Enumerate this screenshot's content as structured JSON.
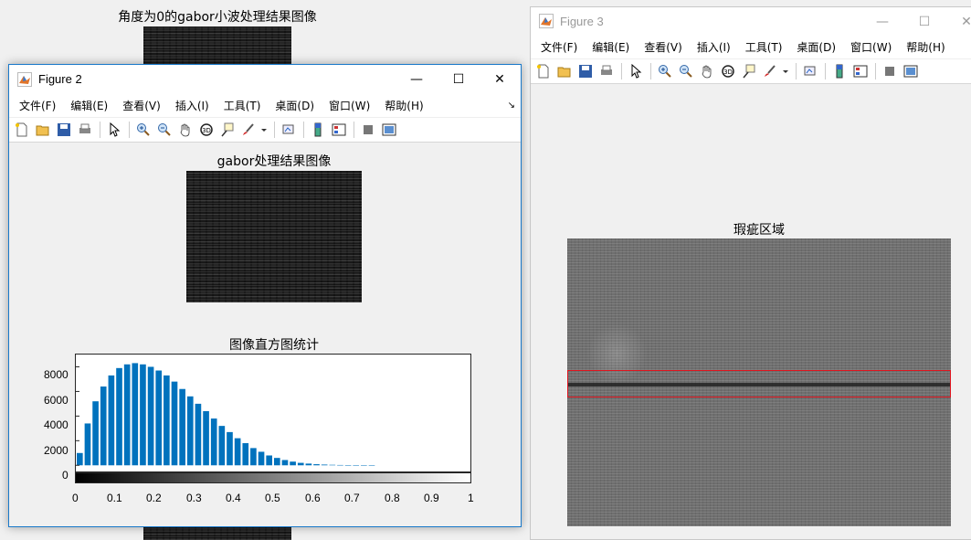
{
  "background_figure": {
    "title": "角度为0的gabor小波处理结果图像"
  },
  "figure2": {
    "window_title": "Figure 2",
    "menu": [
      "文件(F)",
      "编辑(E)",
      "查看(V)",
      "插入(I)",
      "工具(T)",
      "桌面(D)",
      "窗口(W)",
      "帮助(H)"
    ],
    "resize_glyph": "↘",
    "image_title": "gabor处理结果图像",
    "histogram_title": "图像直方图统计",
    "chart_data": {
      "type": "bar",
      "title": "图像直方图统计",
      "xlim": [
        0,
        1
      ],
      "ylim": [
        -500,
        9000
      ],
      "yticks": [
        0,
        2000,
        4000,
        6000,
        8000
      ],
      "xticks": [
        0,
        0.1,
        0.2,
        0.3,
        0.4,
        0.5,
        0.6,
        0.7,
        0.8,
        0.9,
        1
      ],
      "ytick_labels": [
        "8000",
        "6000",
        "4000",
        "2000",
        "0"
      ],
      "xtick_labels": [
        "0",
        "0.1",
        "0.2",
        "0.3",
        "0.4",
        "0.5",
        "0.6",
        "0.7",
        "0.8",
        "0.9",
        "1"
      ],
      "colorbar": "gray",
      "bar_color": "#0072bd",
      "x": [
        0.0,
        0.02,
        0.04,
        0.06,
        0.08,
        0.1,
        0.12,
        0.14,
        0.16,
        0.18,
        0.2,
        0.22,
        0.24,
        0.26,
        0.28,
        0.3,
        0.32,
        0.34,
        0.36,
        0.38,
        0.4,
        0.42,
        0.44,
        0.46,
        0.48,
        0.5,
        0.52,
        0.54,
        0.56,
        0.58,
        0.6,
        0.62,
        0.64,
        0.66,
        0.68,
        0.7,
        0.72,
        0.74
      ],
      "values": [
        1000,
        3400,
        5200,
        6400,
        7300,
        7900,
        8200,
        8300,
        8200,
        8000,
        7700,
        7300,
        6800,
        6200,
        5600,
        5000,
        4400,
        3800,
        3200,
        2700,
        2200,
        1800,
        1400,
        1100,
        800,
        600,
        430,
        300,
        200,
        140,
        90,
        60,
        40,
        25,
        15,
        10,
        5,
        3
      ]
    }
  },
  "figure3": {
    "window_title": "Figure 3",
    "menu": [
      "文件(F)",
      "编辑(E)",
      "查看(V)",
      "插入(I)",
      "工具(T)",
      "桌面(D)",
      "窗口(W)",
      "帮助(H)"
    ],
    "image_title": "瑕疵区域"
  },
  "window_buttons": {
    "minimize": "—",
    "maximize": "☐",
    "close": "✕"
  },
  "colors": {
    "defect_box": "#e0141e",
    "active_border": "#1979ca",
    "histogram_bar": "#0072bd"
  }
}
